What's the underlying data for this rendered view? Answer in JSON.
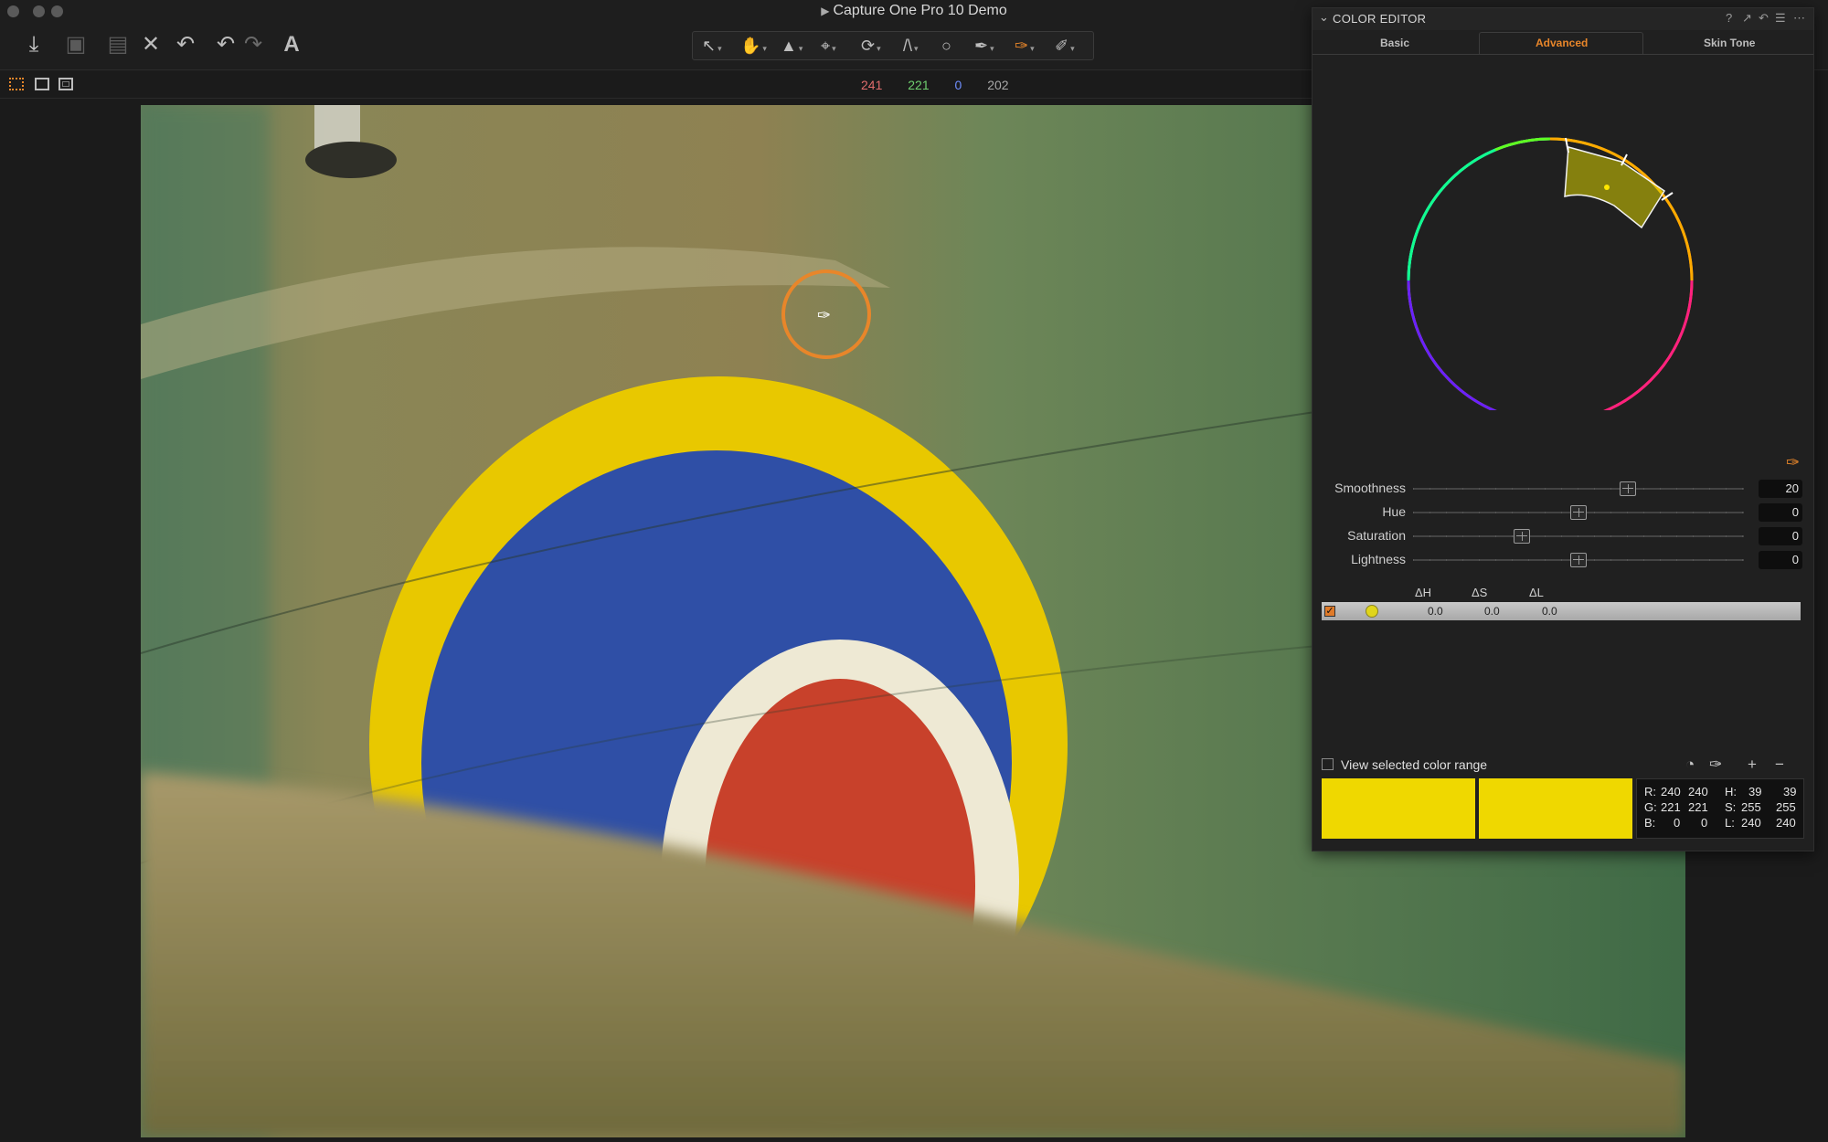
{
  "window": {
    "title": "Capture One Pro 10 Demo"
  },
  "toolbar": {
    "left_icons": [
      "import-icon",
      "camera-icon",
      "export-icon",
      "delete-icon",
      "undo-icon",
      "undo-alt-icon",
      "redo-icon",
      "text-icon"
    ],
    "cursor_tools": [
      "pointer-tool-icon",
      "pan-tool-icon",
      "keystone-tool-icon",
      "crop-tool-icon",
      "rotate-tool-icon",
      "straighten-tool-icon",
      "spot-tool-icon",
      "brush-tool-icon",
      "color-picker-tool-icon",
      "annotate-tool-icon"
    ]
  },
  "viewbar": {
    "readout": {
      "r": "241",
      "g": "221",
      "b": "0",
      "l": "202"
    }
  },
  "panel": {
    "title": "COLOR EDITOR",
    "tabs": {
      "basic": "Basic",
      "advanced": "Advanced",
      "skin": "Skin Tone"
    },
    "sliders": {
      "smoothness": {
        "label": "Smoothness",
        "value": "20",
        "level": 0.65
      },
      "hue": {
        "label": "Hue",
        "value": "0",
        "level": 0.5
      },
      "saturation": {
        "label": "Saturation",
        "value": "0",
        "level": 0.33
      },
      "lightness": {
        "label": "Lightness",
        "value": "0",
        "level": 0.5
      }
    },
    "list": {
      "headers": {
        "dh": "ΔH",
        "ds": "ΔS",
        "dl": "ΔL"
      },
      "row": {
        "dh": "0.0",
        "ds": "0.0",
        "dl": "0.0",
        "checked": true
      }
    },
    "view_range_label": "View selected color range",
    "readout": {
      "r_label": "R:",
      "r1": "240",
      "r2": "240",
      "g_label": "G:",
      "g1": "221",
      "g2": "221",
      "b_label": "B:",
      "b1": "0",
      "b2": "0",
      "h_label": "H:",
      "h1": "39",
      "h2": "39",
      "s_label": "S:",
      "s1": "255",
      "s2": "255",
      "l_label": "L:",
      "l1": "240",
      "l2": "240"
    },
    "swatch_color": "#efd800"
  },
  "colors": {
    "accent": "#e8862a",
    "readout_r": "#e06c6c",
    "readout_g": "#6fcf6f",
    "readout_b": "#6f8fff"
  }
}
